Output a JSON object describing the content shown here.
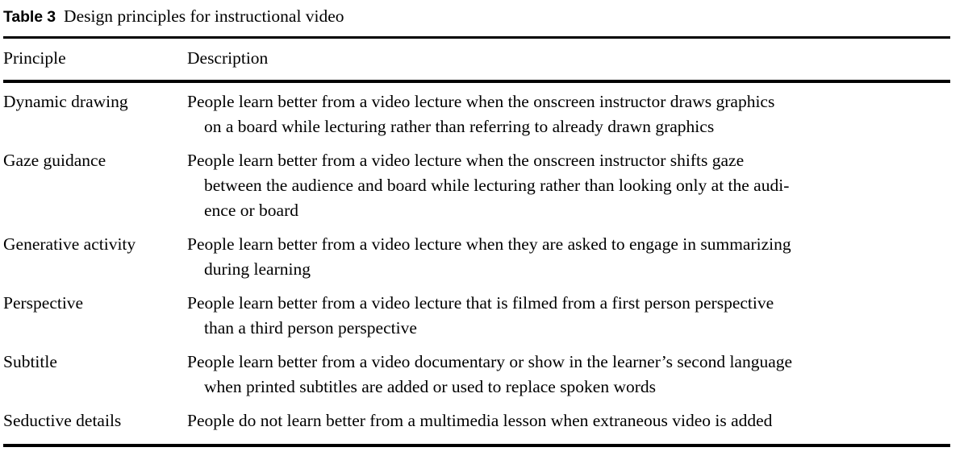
{
  "caption": {
    "label": "Table 3",
    "text": "Design principles for instructional video"
  },
  "table": {
    "columns": {
      "principle": "Principle",
      "description": "Description"
    },
    "rows": [
      {
        "principle": "Dynamic drawing",
        "description": "People learn better from a video lecture when the onscreen instructor draws graphics on a board while lecturing rather than referring to already drawn graphics",
        "lines": [
          "People learn better from a video lecture when the onscreen instructor draws graphics",
          "on a board while lecturing rather than referring to already drawn graphics"
        ]
      },
      {
        "principle": "Gaze guidance",
        "description": "People learn better from a video lecture when the onscreen instructor shifts gaze between the audience and board while lecturing rather than looking only at the audience or board",
        "lines": [
          "People learn better from a video lecture when the onscreen instructor shifts gaze",
          "between the audience and board while lecturing rather than looking only at the audi-",
          "ence or board"
        ]
      },
      {
        "principle": "Generative activity",
        "description": "People learn better from a video lecture when they are asked to engage in summarizing during learning",
        "lines": [
          "People learn better from a video lecture when they are asked to engage in summarizing",
          "during learning"
        ]
      },
      {
        "principle": "Perspective",
        "description": "People learn better from a video lecture that is filmed from a first person perspective than a third person perspective",
        "lines": [
          "People learn better from a video lecture that is filmed from a first person perspective",
          "than a third person perspective"
        ]
      },
      {
        "principle": "Subtitle",
        "description": "People learn better from a video documentary or show in the learner’s second language when printed subtitles are added or used to replace spoken words",
        "lines": [
          "People learn better from a video documentary or show in the learner’s second language",
          "when printed subtitles are added or used to replace spoken words"
        ]
      },
      {
        "principle": "Seductive details",
        "description": "People do not learn better from a multimedia lesson when extraneous video is added",
        "lines": [
          "People do not learn better from a multimedia lesson when extraneous video is added"
        ]
      }
    ]
  }
}
